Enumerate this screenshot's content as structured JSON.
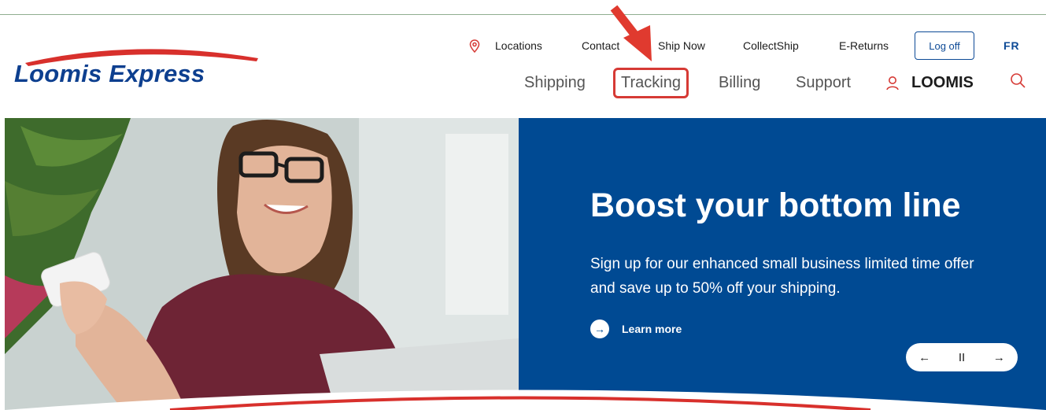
{
  "logo": {
    "text": "Loomis Express"
  },
  "utility_nav": {
    "locations": "Locations",
    "contact": "Contact",
    "ship_now": "Ship Now",
    "collectship": "CollectShip",
    "ereturns": "E-Returns",
    "logoff": "Log off",
    "language": "FR"
  },
  "main_nav": {
    "shipping": "Shipping",
    "tracking": "Tracking",
    "billing": "Billing",
    "support": "Support",
    "account": "LOOMIS"
  },
  "hero": {
    "headline": "Boost your bottom line",
    "subtext": "Sign up for our enhanced small business limited time offer and save up to 50% off your shipping.",
    "cta": "Learn more",
    "controls": {
      "prev": "←",
      "pause": "II",
      "next": "→"
    }
  },
  "colors": {
    "brand_blue": "#004a93",
    "logo_blue": "#0d3f8f",
    "highlight_red": "#d63a35",
    "swoosh_red": "#d8302c"
  },
  "icons": [
    "location-pin-icon",
    "user-icon",
    "search-icon",
    "arrow-left-icon",
    "pause-icon",
    "arrow-right-icon",
    "arrow-right-circle-icon"
  ]
}
